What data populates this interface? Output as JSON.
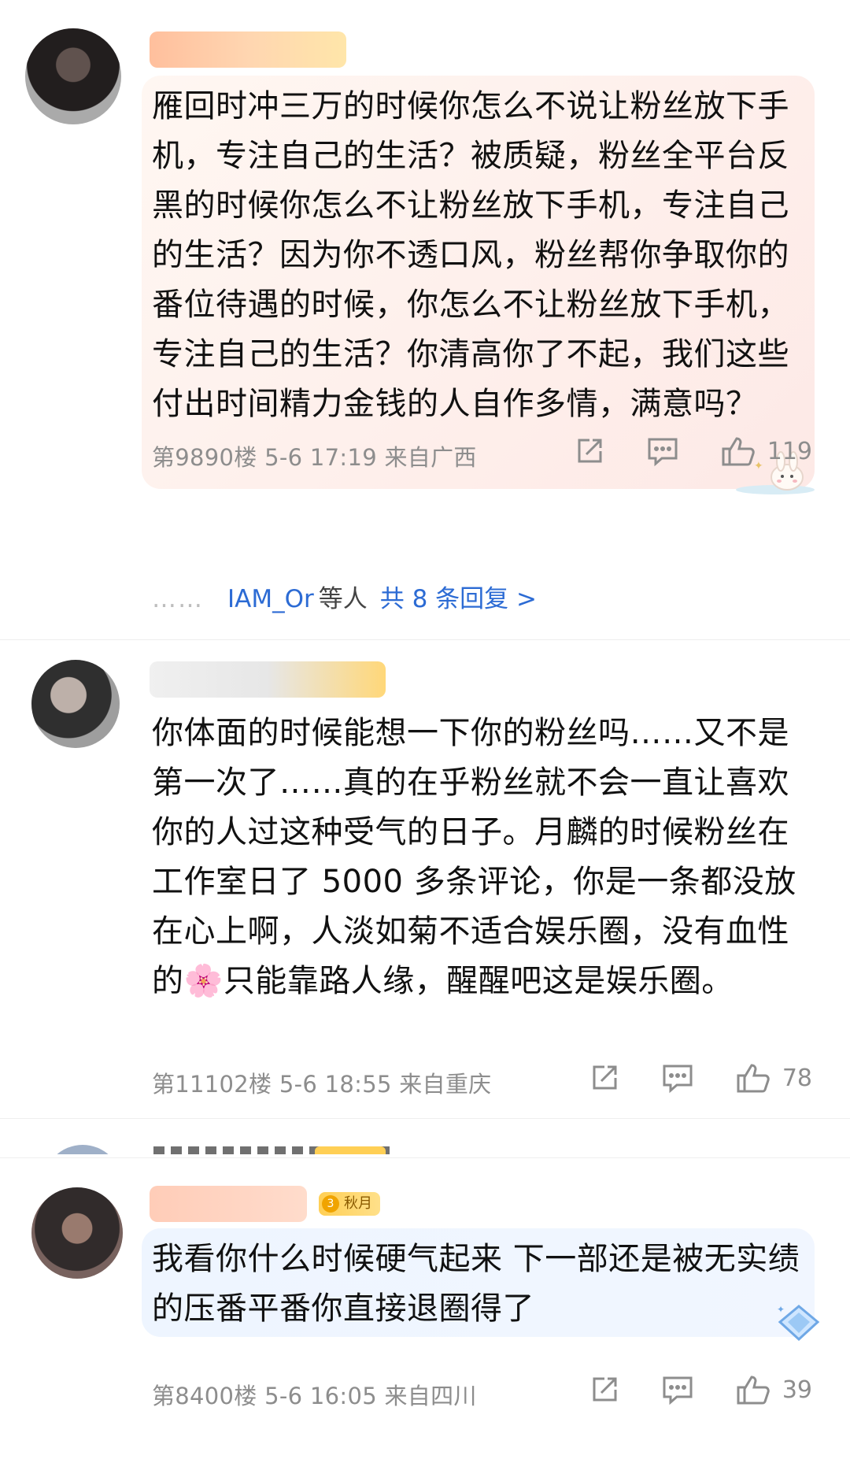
{
  "comments": [
    {
      "text": "雁回时冲三万的时候你怎么不说让粉丝放下手机，专注自己的生活？被质疑，粉丝全平台反黑的时候你怎么不让粉丝放下手机，专注自己的生活？因为你不透口风，粉丝帮你争取你的番位待遇的时候，你怎么不让粉丝放下手机，专注自己的生活？你清高你了不起，我们这些付出时间精力金钱的人自作多情，满意吗？",
      "meta": "第9890楼 5-6 17:19 来自广西",
      "likes": "119",
      "replies": {
        "dots": "……",
        "who": "IAM_Or",
        "mid": "等人",
        "link": "共 8 条回复 >"
      }
    },
    {
      "text_before": "你体面的时候能想一下你的粉丝吗……又不是第一次了……真的在乎粉丝就不会一直让喜欢你的人过这种受气的日子。月麟的时候粉丝在工作室日了 5000 多条评论，你是一条都没放在心上啊，人淡如菊不适合娱乐圈，没有血性的",
      "emoji": "🌸",
      "text_after": "只能靠路人缘，醒醒吧这是娱乐圈。",
      "meta": "第11102楼 5-6 18:55 来自重庆",
      "likes": "78"
    },
    {
      "badge_level": "3",
      "badge_label": "秋月",
      "text": "我看你什么时候硬气起来 下一部还是被无实绩的压番平番你直接退圈得了",
      "meta": "第8400楼 5-6 16:05 来自四川",
      "likes": "39"
    }
  ]
}
